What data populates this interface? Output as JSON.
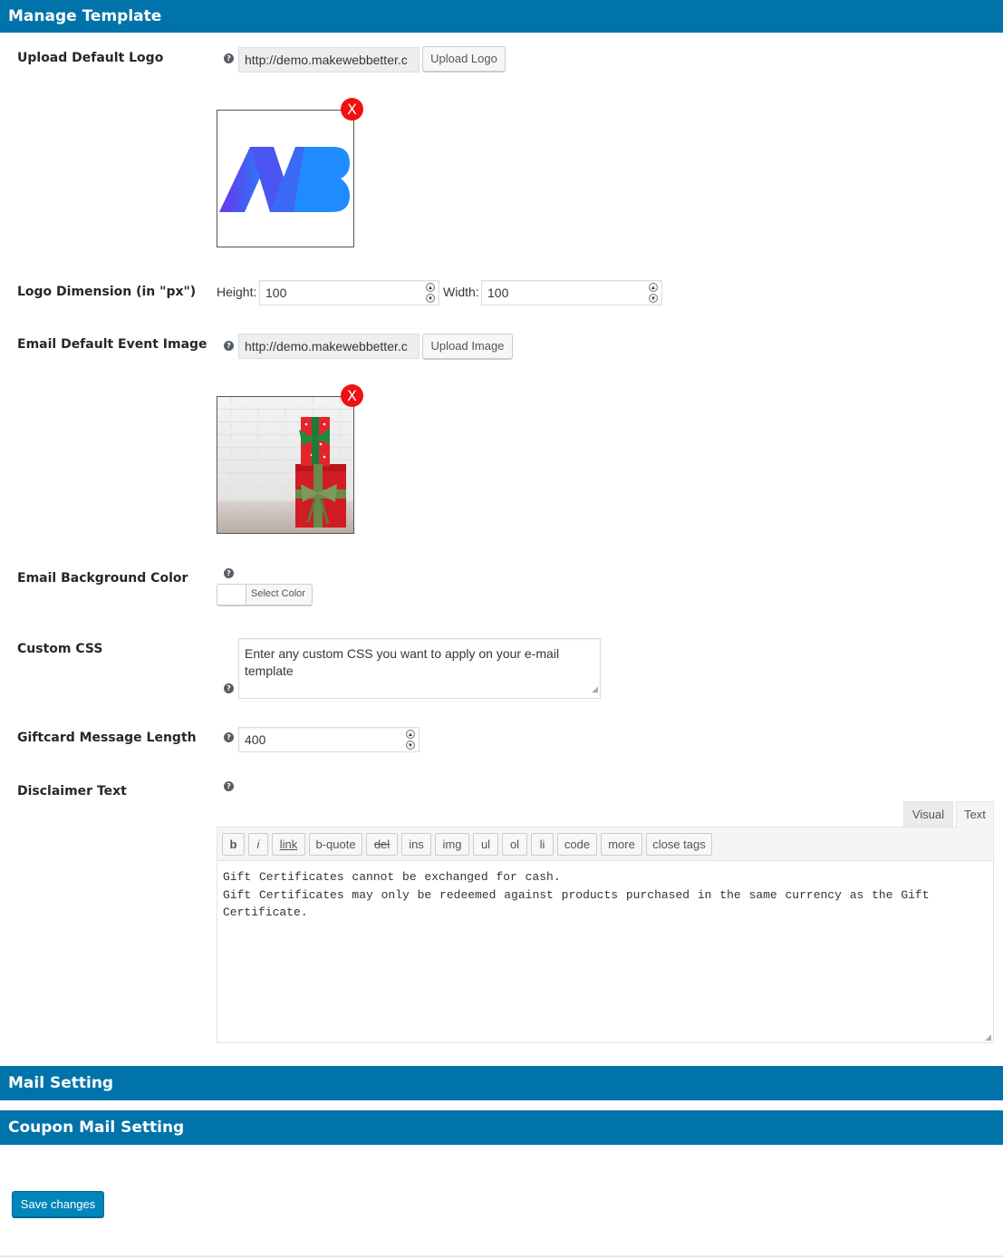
{
  "sections": {
    "manage_template": "Manage Template",
    "mail_setting": "Mail Setting",
    "coupon_mail_setting": "Coupon Mail Setting"
  },
  "upload_logo": {
    "label": "Upload Default Logo",
    "help": "?",
    "url_value": "http://demo.makewebbetter.c",
    "button": "Upload Logo",
    "remove": "X",
    "logo_text": "MWB"
  },
  "logo_dimension": {
    "label": "Logo Dimension (in \"px\")",
    "height_label": "Height:",
    "height_value": "100",
    "width_label": "Width:",
    "width_value": "100"
  },
  "event_image": {
    "label": "Email Default Event Image",
    "help": "?",
    "url_value": "http://demo.makewebbetter.c",
    "button": "Upload Image",
    "remove": "X"
  },
  "bg_color": {
    "label": "Email Background Color",
    "help": "?",
    "button": "Select Color"
  },
  "custom_css": {
    "label": "Custom CSS",
    "help": "?",
    "placeholder": "Enter any custom CSS you want to apply on your e-mail template"
  },
  "message_length": {
    "label": "Giftcard Message Length",
    "help": "?",
    "value": "400"
  },
  "disclaimer": {
    "label": "Disclaimer Text",
    "help": "?",
    "tabs": [
      "Visual",
      "Text"
    ],
    "active_tab": "Text",
    "quicktags": [
      "b",
      "i",
      "link",
      "b-quote",
      "del",
      "ins",
      "img",
      "ul",
      "ol",
      "li",
      "code",
      "more",
      "close tags"
    ],
    "content": "Gift Certificates cannot be exchanged for cash.\nGift Certificates may only be redeemed against products purchased in the same currency as the Gift Certificate."
  },
  "save_button": "Save changes",
  "colors": {
    "header_bar": "#0073aa",
    "primary_button": "#0085ba",
    "remove_badge": "#ee1111"
  }
}
